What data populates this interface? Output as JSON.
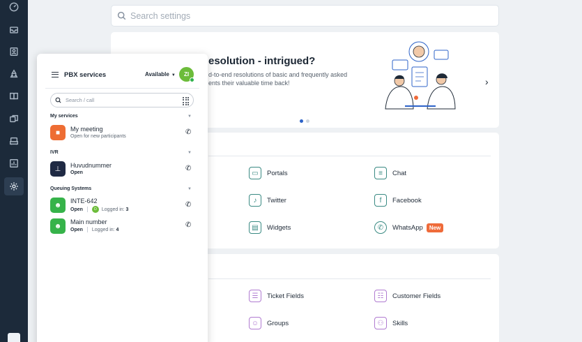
{
  "rail": {
    "items": [
      "speedometer-icon",
      "inbox-icon",
      "contact-icon",
      "recycle-icon",
      "book-icon",
      "copy-icon",
      "sofa-icon",
      "chart-icon",
      "gear-icon"
    ]
  },
  "search": {
    "placeholder": "Search settings"
  },
  "banner": {
    "title": "esolution - intrigued?",
    "subtitle_line1": "d-to-end resolutions of basic and frequently asked",
    "subtitle_line2": "ents their valuable time back!",
    "next": "›"
  },
  "channels": {
    "portals": "Portals",
    "chat": "Chat",
    "twitter": "Twitter",
    "facebook": "Facebook",
    "widgets": "Widgets",
    "whatsapp": "WhatsApp",
    "new_badge": "New"
  },
  "fields": {
    "ticket_fields": "Ticket Fields",
    "customer_fields": "Customer Fields",
    "groups": "Groups",
    "skills": "Skills"
  },
  "pbx": {
    "title": "PBX services",
    "status": "Available",
    "avatar_initials": "ZI",
    "search_placeholder": "Search / call",
    "sections": {
      "my_services": "My services",
      "ivr": "IVR",
      "queuing": "Queuing Systems"
    },
    "services": {
      "meeting_name": "My meeting",
      "meeting_sub": "Open for new participants",
      "ivr_name": "Huvudnummer",
      "ivr_status": "Open",
      "q1_name": "INTE-642",
      "q1_status": "Open",
      "q1_avatar": "D",
      "q1_logged_label": "Logged in:",
      "q1_logged_count": "3",
      "q2_name": "Main number",
      "q2_status": "Open",
      "q2_logged_label": "Logged in:",
      "q2_logged_count": "4"
    }
  },
  "colors": {
    "rail_bg": "#1c2a3a",
    "meeting_icon": "#ee6d33",
    "ivr_icon": "#1f2a44",
    "queue_icon": "#36b34a",
    "avatar": "#6cbc3a",
    "accent_teal": "#3a8a83",
    "accent_purple": "#b07bd1",
    "badge_new": "#ef6b3a"
  }
}
